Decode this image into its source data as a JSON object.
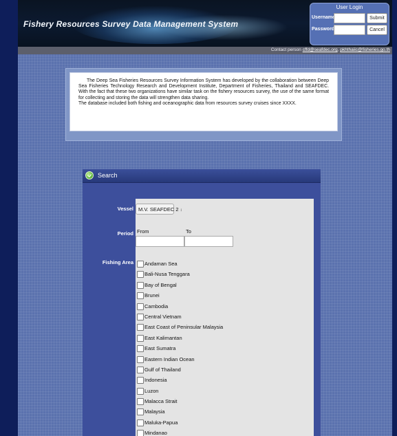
{
  "header": {
    "site_title": "Fishery Resources Survey Data Management System",
    "login": {
      "title": "User Login",
      "username_label": "Username",
      "password_label": "Password",
      "submit_label": "Submit",
      "cancel_label": "Cancel"
    },
    "contact": {
      "label": "Contact person",
      "email1": "cffd@seafdec.org",
      "separator": ",",
      "email2": "pkhthaiic@fisheries.go.th"
    }
  },
  "intro": {
    "paragraph1": "The Deep Sea Fisheries Resources Survey Information System has developed by the collaboration between Deep Sea Fisheries Technology Research and Development Institute, Department of Fisheries, Thailand and SEAFDEC. With the fact that these two organizations have similar task on the fishery resources survey, the use of the same format for collecting and storing the data will strengthen data sharing.",
    "paragraph2": "The database included both fishing and oceanographic data from resources survey cruises since XXXX."
  },
  "search": {
    "title": "Search",
    "vessel_label": "Vessel",
    "vessel_value": "M.V. SEAFDEC 2",
    "vessel_arrows": "↕",
    "period_label": "Period",
    "from_label": "From",
    "to_label": "To",
    "from_value": "",
    "to_value": "",
    "fishing_area_label": "Fishing Area",
    "areas": [
      "Andaman Sea",
      "Bali-Nusa Tenggara",
      "Bay of Bengal",
      "Brunei",
      "Cambodia",
      "Central Vietnam",
      "East Coast of Peninsular Malaysia",
      "East Kalimantan",
      "East Sumatra",
      "Eastern Indian Ocean",
      "Gulf of Thailand",
      "Indonesia",
      "Luzon",
      "Malacca Strait",
      "Malaysia",
      "Maluka-Papua",
      "Mindanao"
    ]
  },
  "colors": {
    "page_background": "#5b72ae",
    "outer_background": "#0e1e5a",
    "search_header": "#2f4286",
    "login_box": "#5570b4"
  }
}
